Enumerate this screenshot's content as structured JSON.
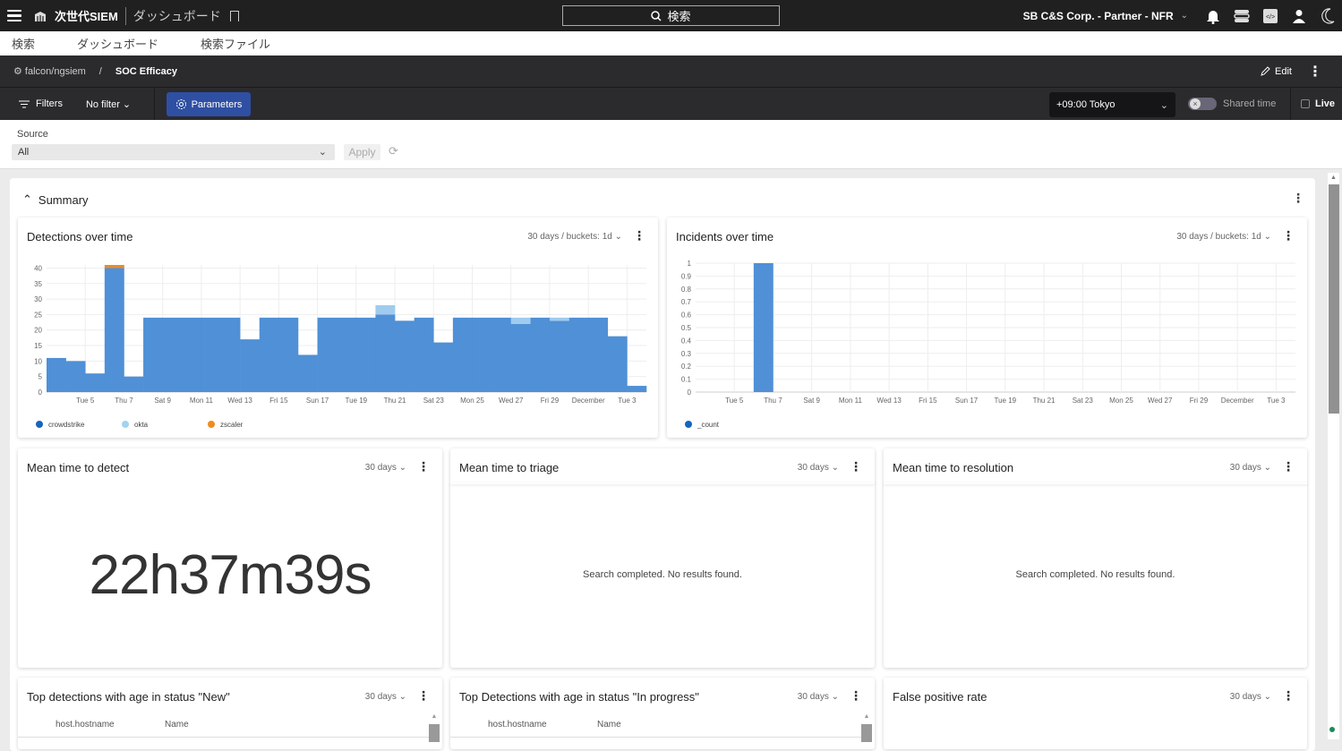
{
  "topbar": {
    "app_name": "次世代SIEM",
    "page": "ダッシュボード",
    "search_label": "検索",
    "org": "SB C&S Corp. - Partner - NFR"
  },
  "nav": [
    "検索",
    "ダッシュボード",
    "検索ファイル"
  ],
  "breadcrumb": {
    "repo": "falcon/ngsiem",
    "separator": "/",
    "dashboard": "SOC Efficacy",
    "edit_label": "Edit"
  },
  "filterbar": {
    "filters_label": "Filters",
    "filter_value": "No filter",
    "parameters_label": "Parameters",
    "timezone": "+09:00 Tokyo",
    "shared_time_label": "Shared time",
    "shared_time_on": false,
    "live_label": "Live",
    "live_checked": false
  },
  "parameters": {
    "source_label": "Source",
    "source_value": "All",
    "apply_label": "Apply"
  },
  "section": {
    "title": "Summary"
  },
  "widgets": {
    "detections": {
      "title": "Detections over time",
      "range": "30 days / buckets: 1d"
    },
    "incidents": {
      "title": "Incidents over time",
      "range": "30 days / buckets: 1d"
    },
    "mttd": {
      "title": "Mean time to detect",
      "range": "30 days",
      "value": "22h37m39s"
    },
    "mttt": {
      "title": "Mean time to triage",
      "range": "30 days",
      "message": "Search completed. No results found."
    },
    "mttr": {
      "title": "Mean time to resolution",
      "range": "30 days",
      "message": "Search completed. No results found."
    },
    "top_new": {
      "title": "Top detections with age in status \"New\"",
      "range": "30 days",
      "columns": [
        "host.hostname",
        "Name"
      ]
    },
    "top_inprogress": {
      "title": "Top Detections with age in status \"In progress\"",
      "range": "30 days",
      "columns": [
        "host.hostname",
        "Name"
      ]
    },
    "fpr": {
      "title": "False positive rate",
      "range": "30 days"
    }
  },
  "chart_data": [
    {
      "type": "bar",
      "title": "Detections over time",
      "stacked": true,
      "categories": [
        "Sun 3",
        "Mon 4",
        "Tue 5",
        "Wed 6",
        "Thu 7",
        "Fri 8",
        "Sat 9",
        "Sun 10",
        "Mon 11",
        "Tue 12",
        "Wed 13",
        "Thu 14",
        "Fri 15",
        "Sat 16",
        "Sun 17",
        "Mon 18",
        "Tue 19",
        "Wed 20",
        "Thu 21",
        "Fri 22",
        "Sat 23",
        "Sun 24",
        "Mon 25",
        "Tue 26",
        "Wed 27",
        "Thu 28",
        "Fri 29",
        "Sat 30",
        "December",
        "Mon 2",
        "Tue 3"
      ],
      "tick_labels": [
        "Tue 5",
        "Thu 7",
        "Sat 9",
        "Mon 11",
        "Wed 13",
        "Fri 15",
        "Sun 17",
        "Tue 19",
        "Thu 21",
        "Sat 23",
        "Mon 25",
        "Wed 27",
        "Fri 29",
        "December",
        "Tue 3"
      ],
      "series": [
        {
          "name": "crowdstrike",
          "color": "#4f90d6",
          "values": [
            11,
            10,
            6,
            40,
            5,
            24,
            24,
            24,
            24,
            24,
            17,
            24,
            24,
            12,
            24,
            24,
            24,
            25,
            23,
            24,
            16,
            24,
            24,
            24,
            22,
            24,
            23,
            24,
            24,
            18,
            2
          ]
        },
        {
          "name": "okta",
          "color": "#9fcbee",
          "values": [
            0,
            0,
            0,
            0,
            0,
            0,
            0,
            0,
            0,
            0,
            0,
            0,
            0,
            0,
            0,
            0,
            0,
            3,
            0,
            0,
            0,
            0,
            0,
            0,
            2,
            0,
            1,
            0,
            0,
            0,
            0
          ]
        },
        {
          "name": "zscaler",
          "color": "#e88a2e",
          "values": [
            0,
            0,
            0,
            1,
            0,
            0,
            0,
            0,
            0,
            0,
            0,
            0,
            0,
            0,
            0,
            0,
            0,
            0,
            0,
            0,
            0,
            0,
            0,
            0,
            0,
            0,
            0,
            0,
            0,
            0,
            0
          ]
        }
      ],
      "yticks": [
        0,
        5,
        10,
        15,
        20,
        25,
        30,
        35,
        40
      ],
      "ylim": [
        0,
        41
      ],
      "legend": "bottom-left",
      "grid": true
    },
    {
      "type": "bar",
      "title": "Incidents over time",
      "categories": [
        "Sun 3",
        "Mon 4",
        "Tue 5",
        "Wed 6",
        "Thu 7",
        "Fri 8",
        "Sat 9",
        "Sun 10",
        "Mon 11",
        "Tue 12",
        "Wed 13",
        "Thu 14",
        "Fri 15",
        "Sat 16",
        "Sun 17",
        "Mon 18",
        "Tue 19",
        "Wed 20",
        "Thu 21",
        "Fri 22",
        "Sat 23",
        "Sun 24",
        "Mon 25",
        "Tue 26",
        "Wed 27",
        "Thu 28",
        "Fri 29",
        "Sat 30",
        "December",
        "Mon 2",
        "Tue 3"
      ],
      "tick_labels": [
        "Tue 5",
        "Thu 7",
        "Sat 9",
        "Mon 11",
        "Wed 13",
        "Fri 15",
        "Sun 17",
        "Tue 19",
        "Thu 21",
        "Sat 23",
        "Mon 25",
        "Wed 27",
        "Fri 29",
        "December",
        "Tue 3"
      ],
      "series": [
        {
          "name": "_count",
          "color": "#4f90d6",
          "values": [
            0,
            0,
            0,
            1,
            0,
            0,
            0,
            0,
            0,
            0,
            0,
            0,
            0,
            0,
            0,
            0,
            0,
            0,
            0,
            0,
            0,
            0,
            0,
            0,
            0,
            0,
            0,
            0,
            0,
            0,
            0
          ]
        }
      ],
      "yticks": [
        0,
        0.1,
        0.2,
        0.3,
        0.4,
        0.5,
        0.6,
        0.7,
        0.8,
        0.9,
        1
      ],
      "ylim": [
        0,
        1
      ],
      "legend": "bottom-left",
      "grid": true
    }
  ]
}
